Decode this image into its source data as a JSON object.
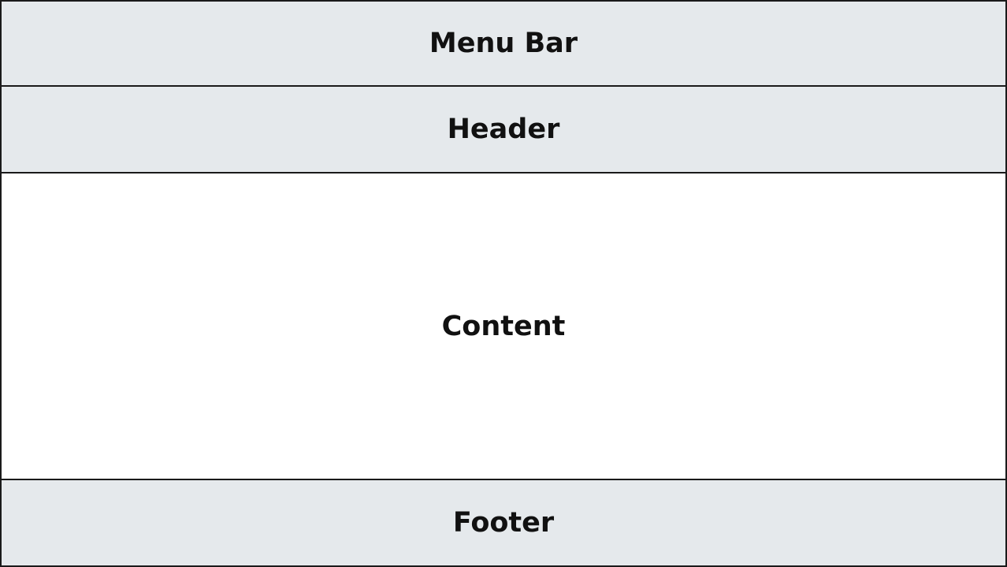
{
  "diagram": {
    "menu_bar": {
      "label": "Menu Bar"
    },
    "header": {
      "label": "Header"
    },
    "content": {
      "label": "Content"
    },
    "footer": {
      "label": "Footer"
    }
  },
  "colors": {
    "band_fill": "#e5e9ec",
    "content_fill": "#ffffff",
    "border": "#1a1a1a",
    "text": "#111111"
  }
}
